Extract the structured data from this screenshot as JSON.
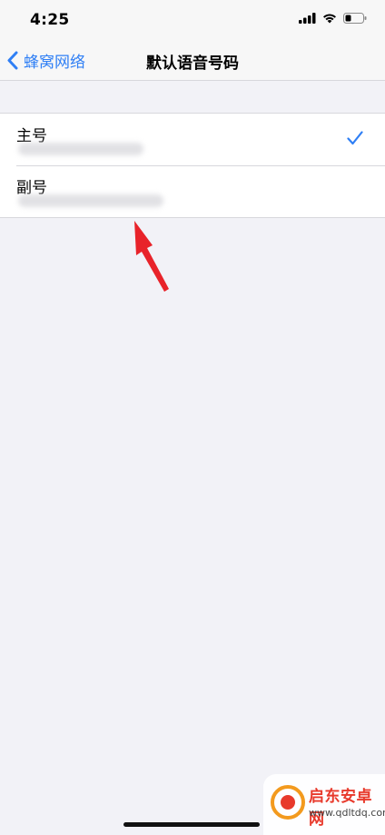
{
  "status_bar": {
    "time": "4:25",
    "icons": [
      "signal-icon",
      "wifi-icon",
      "battery-icon"
    ]
  },
  "nav": {
    "back_label": "蜂窝网络",
    "title": "默认语音号码"
  },
  "lines": [
    {
      "label": "主号",
      "selected": true
    },
    {
      "label": "副号",
      "selected": false
    }
  ],
  "watermark": {
    "name": "启东安卓网",
    "url": "www.qdltdq.com"
  },
  "colors": {
    "accent": "#2f7ff5",
    "background": "#f2f2f7",
    "arrow": "#e8232a"
  }
}
